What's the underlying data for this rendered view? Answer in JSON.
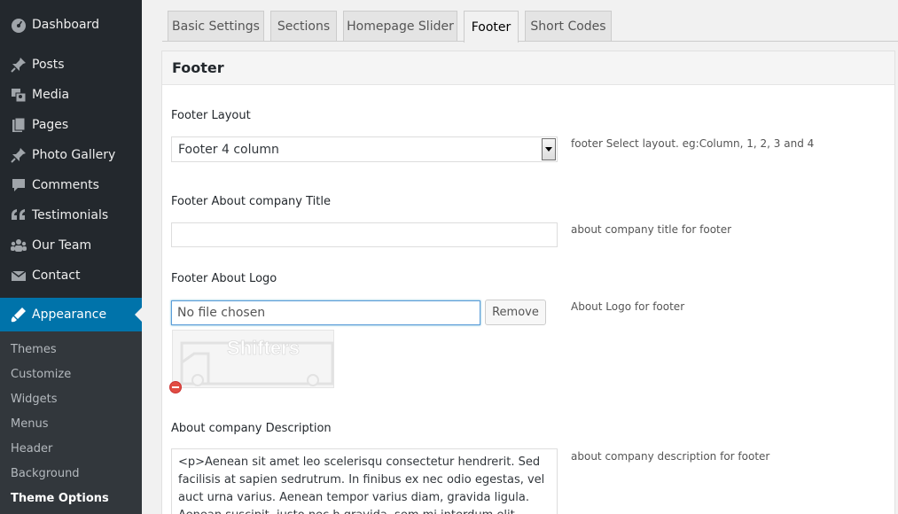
{
  "sidebar": {
    "items": [
      {
        "label": "Dashboard",
        "icon": "dashboard-icon"
      },
      {
        "label": "Posts",
        "icon": "pin-icon"
      },
      {
        "label": "Media",
        "icon": "media-icon"
      },
      {
        "label": "Pages",
        "icon": "pages-icon"
      },
      {
        "label": "Photo Gallery",
        "icon": "pin-icon"
      },
      {
        "label": "Comments",
        "icon": "comment-icon"
      },
      {
        "label": "Testimonials",
        "icon": "quote-icon"
      },
      {
        "label": "Our Team",
        "icon": "groups-icon"
      },
      {
        "label": "Contact",
        "icon": "email-icon"
      }
    ],
    "current": {
      "label": "Appearance",
      "icon": "appearance-icon"
    },
    "submenu": [
      "Themes",
      "Customize",
      "Widgets",
      "Menus",
      "Header",
      "Background",
      "Theme Options"
    ],
    "active_submenu": "Theme Options"
  },
  "tabs": [
    "Basic Settings",
    "Sections",
    "Homepage Slider",
    "Footer",
    "Short Codes"
  ],
  "active_tab": "Footer",
  "panel": {
    "title": "Footer",
    "fields": {
      "layout": {
        "label": "Footer Layout",
        "value": "Footer 4 column",
        "description": "footer Select layout. eg:Column, 1, 2, 3 and 4"
      },
      "about_title": {
        "label": "Footer About company Title",
        "value": "",
        "description": "about company title for footer"
      },
      "about_logo": {
        "label": "Footer About Logo",
        "file_text": "No file chosen",
        "remove_label": "Remove",
        "description": "About Logo for footer",
        "logo_text": "Shifters"
      },
      "about_description": {
        "label": "About company Description",
        "value": "<p>Aenean sit amet leo scelerisqu consectetur hendrerit. Sed facilisis at sapien sedrutrum. In finibus ex nec odio egestas, vel auct urna varius. Aenean tempor varius diam, gravida ligula. Aenean suscipit, justo nec h gravida, sem mi interdum elit, vitae suscipit n lacus sed",
        "description": "about company description for footer"
      }
    }
  },
  "colors": {
    "sidebar_bg": "#23282d",
    "submenu_bg": "#32373c",
    "accent": "#0073aa"
  }
}
